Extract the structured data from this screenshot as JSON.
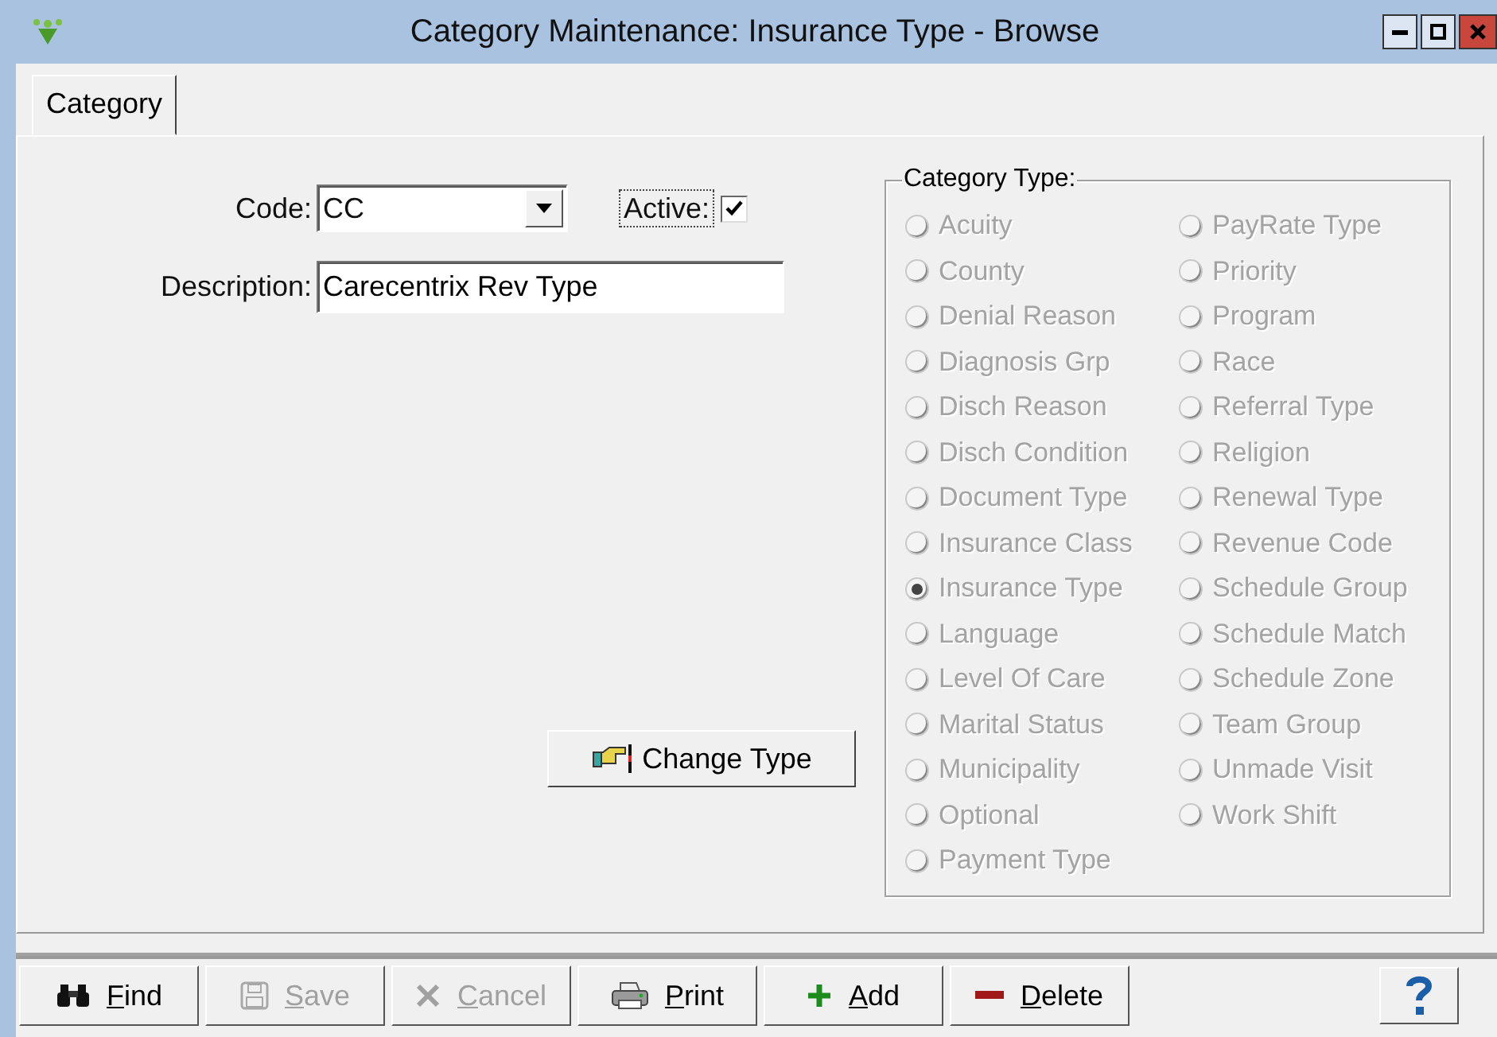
{
  "window": {
    "title": "Category Maintenance: Insurance Type - Browse"
  },
  "tabs": [
    {
      "label": "Category",
      "selected": true
    }
  ],
  "form": {
    "code": {
      "label": "Code:",
      "value": "CC"
    },
    "active": {
      "label": "Active:",
      "checked": true
    },
    "description": {
      "label": "Description:",
      "value": "Carecentrix Rev Type"
    }
  },
  "category_type": {
    "legend": "Category Type:",
    "options": [
      {
        "label": "Acuity",
        "selected": false,
        "disabled": true
      },
      {
        "label": "County",
        "selected": false,
        "disabled": true
      },
      {
        "label": "Denial Reason",
        "selected": false,
        "disabled": true
      },
      {
        "label": "Diagnosis Grp",
        "selected": false,
        "disabled": true
      },
      {
        "label": "Disch Reason",
        "selected": false,
        "disabled": true
      },
      {
        "label": "Disch Condition",
        "selected": false,
        "disabled": true
      },
      {
        "label": "Document Type",
        "selected": false,
        "disabled": true
      },
      {
        "label": "Insurance Class",
        "selected": false,
        "disabled": true
      },
      {
        "label": "Insurance Type",
        "selected": true,
        "disabled": true
      },
      {
        "label": "Language",
        "selected": false,
        "disabled": true
      },
      {
        "label": "Level Of Care",
        "selected": false,
        "disabled": true
      },
      {
        "label": "Marital Status",
        "selected": false,
        "disabled": true
      },
      {
        "label": "Municipality",
        "selected": false,
        "disabled": true
      },
      {
        "label": "Optional",
        "selected": false,
        "disabled": true
      },
      {
        "label": "Payment Type",
        "selected": false,
        "disabled": true
      },
      {
        "label": "PayRate Type",
        "selected": false,
        "disabled": true
      },
      {
        "label": "Priority",
        "selected": false,
        "disabled": true
      },
      {
        "label": "Program",
        "selected": false,
        "disabled": true
      },
      {
        "label": "Race",
        "selected": false,
        "disabled": true
      },
      {
        "label": "Referral Type",
        "selected": false,
        "disabled": true
      },
      {
        "label": "Religion",
        "selected": false,
        "disabled": true
      },
      {
        "label": "Renewal Type",
        "selected": false,
        "disabled": true
      },
      {
        "label": "Revenue Code",
        "selected": false,
        "disabled": true
      },
      {
        "label": "Schedule Group",
        "selected": false,
        "disabled": true
      },
      {
        "label": "Schedule Match",
        "selected": false,
        "disabled": true
      },
      {
        "label": "Schedule Zone",
        "selected": false,
        "disabled": true
      },
      {
        "label": "Team Group",
        "selected": false,
        "disabled": true
      },
      {
        "label": "Unmade Visit",
        "selected": false,
        "disabled": true
      },
      {
        "label": "Work Shift",
        "selected": false,
        "disabled": true
      }
    ]
  },
  "change_type_button": {
    "label": "Change Type"
  },
  "toolbar": [
    {
      "kind": "find",
      "label": "Find",
      "disabled": false
    },
    {
      "kind": "save",
      "label": "Save",
      "disabled": true
    },
    {
      "kind": "cancel",
      "label": "Cancel",
      "disabled": true
    },
    {
      "kind": "print",
      "label": "Print",
      "disabled": false
    },
    {
      "kind": "add",
      "label": "Add",
      "disabled": false
    },
    {
      "kind": "delete",
      "label": "Delete",
      "disabled": false
    }
  ]
}
